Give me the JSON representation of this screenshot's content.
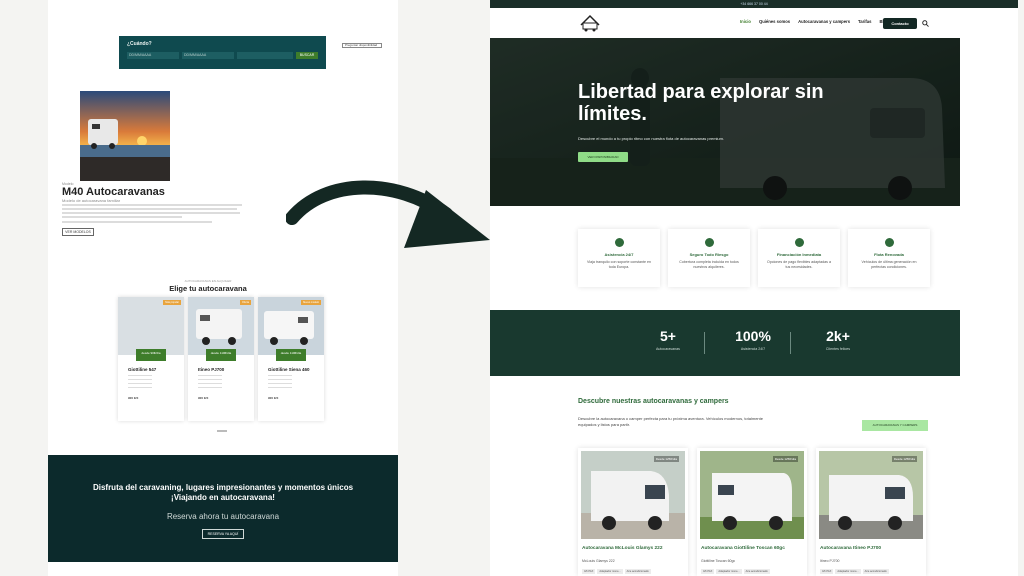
{
  "left": {
    "booking": {
      "question": "¿Cuándo?",
      "from": "DD/MM/AAAA",
      "to": "DD/MM/AAAA",
      "button": "BUSCAR"
    },
    "pill": "Preguntar disponibilidad",
    "model": {
      "small": "Modelo",
      "title": "M40 Autocaravanas",
      "subtitle": "Modelo de autocaravana familiar",
      "button": "VER MODELOS"
    },
    "section": {
      "small": "AUTOCARAVANAS EN ALQUILER",
      "title": "Elige tu autocaravana"
    },
    "cards": [
      {
        "tag": "Más popular",
        "price": "desde 90€/día",
        "name": "Giottiline 547",
        "footer": "900 €/X"
      },
      {
        "tag": "Oferta",
        "price": "desde 110€/día",
        "name": "Itineo PJ700",
        "footer": "900 €/X"
      },
      {
        "tag": "Nuevo modelo",
        "price": "desde 110€/día",
        "name": "Giottiline Siena 460",
        "footer": "900 €/X"
      }
    ],
    "footer": {
      "line1": "Disfruta del caravaning, lugares impresionantes y momentos únicos",
      "line2": "¡Viajando en autocaravana!",
      "line3": "Reserva ahora tu autocaravana",
      "button": "RESERVA YA AQUÍ"
    }
  },
  "right": {
    "topbar": "+34 666 37 00 44",
    "nav": [
      "Inicio",
      "Quiénes somos",
      "Autocaravanas y campers",
      "Tarifas",
      "Blog"
    ],
    "contact_button": "Contacto",
    "hero": {
      "title": "Libertad para explorar sin límites.",
      "desc": "Descubre el mundo a tu propio ritmo con nuestra flota de autocaravanas premium.",
      "cta": "VER DISPONIBILIDAD"
    },
    "features": [
      {
        "title": "Asistencia 24/7",
        "desc": "Viaja tranquilo con soporte constante en toda Europa."
      },
      {
        "title": "Seguro Todo Riesgo",
        "desc": "Cobertura completa incluida en todos nuestros alquileres."
      },
      {
        "title": "Financiación Inmediata",
        "desc": "Opciones de pago flexibles adaptadas a tus necesidades."
      },
      {
        "title": "Flota Renovada",
        "desc": "Vehículos de última generación en perfectas condiciones."
      }
    ],
    "stats": [
      {
        "value": "5+",
        "label": "Autocaravanas"
      },
      {
        "value": "100%",
        "label": "Asistencia 24/7"
      },
      {
        "value": "2k+",
        "label": "Clientes felices"
      }
    ],
    "section": {
      "title": "Descubre nuestras autocaravanas y campers",
      "desc": "Descubre la autocaravana o camper perfecta para tu próxima aventura. Vehículos modernos, totalmente equipados y listos para partir.",
      "button": "AUTOCARAVANAS Y CAMPERS"
    },
    "cards": [
      {
        "badge": "Desde 125€/día",
        "name": "Autocaravana McLouis Glamys 222",
        "sub": "McLouis Glamys 222",
        "chips": [
          "4/6 PAX",
          "Adaptador mone...",
          "Aire acondicionado"
        ]
      },
      {
        "badge": "Desde 125€/día",
        "name": "Autocaravana Giottiline Toscan 60gc",
        "sub": "Giottiline Toscan 60gc",
        "chips": [
          "4/6 PAX",
          "Adaptador mone...",
          "Aire acondicionado"
        ]
      },
      {
        "badge": "Desde 125€/día",
        "name": "Autocaravana Itineo PJ700",
        "sub": "Itineo PJ700",
        "chips": [
          "4/6 PAX",
          "Adaptador mone...",
          "Aire acondicionado"
        ]
      }
    ]
  },
  "colors": {
    "accent_green": "#2f6a3b",
    "dark_teal": "#0c2a2c",
    "light_green": "#8fdc87"
  }
}
